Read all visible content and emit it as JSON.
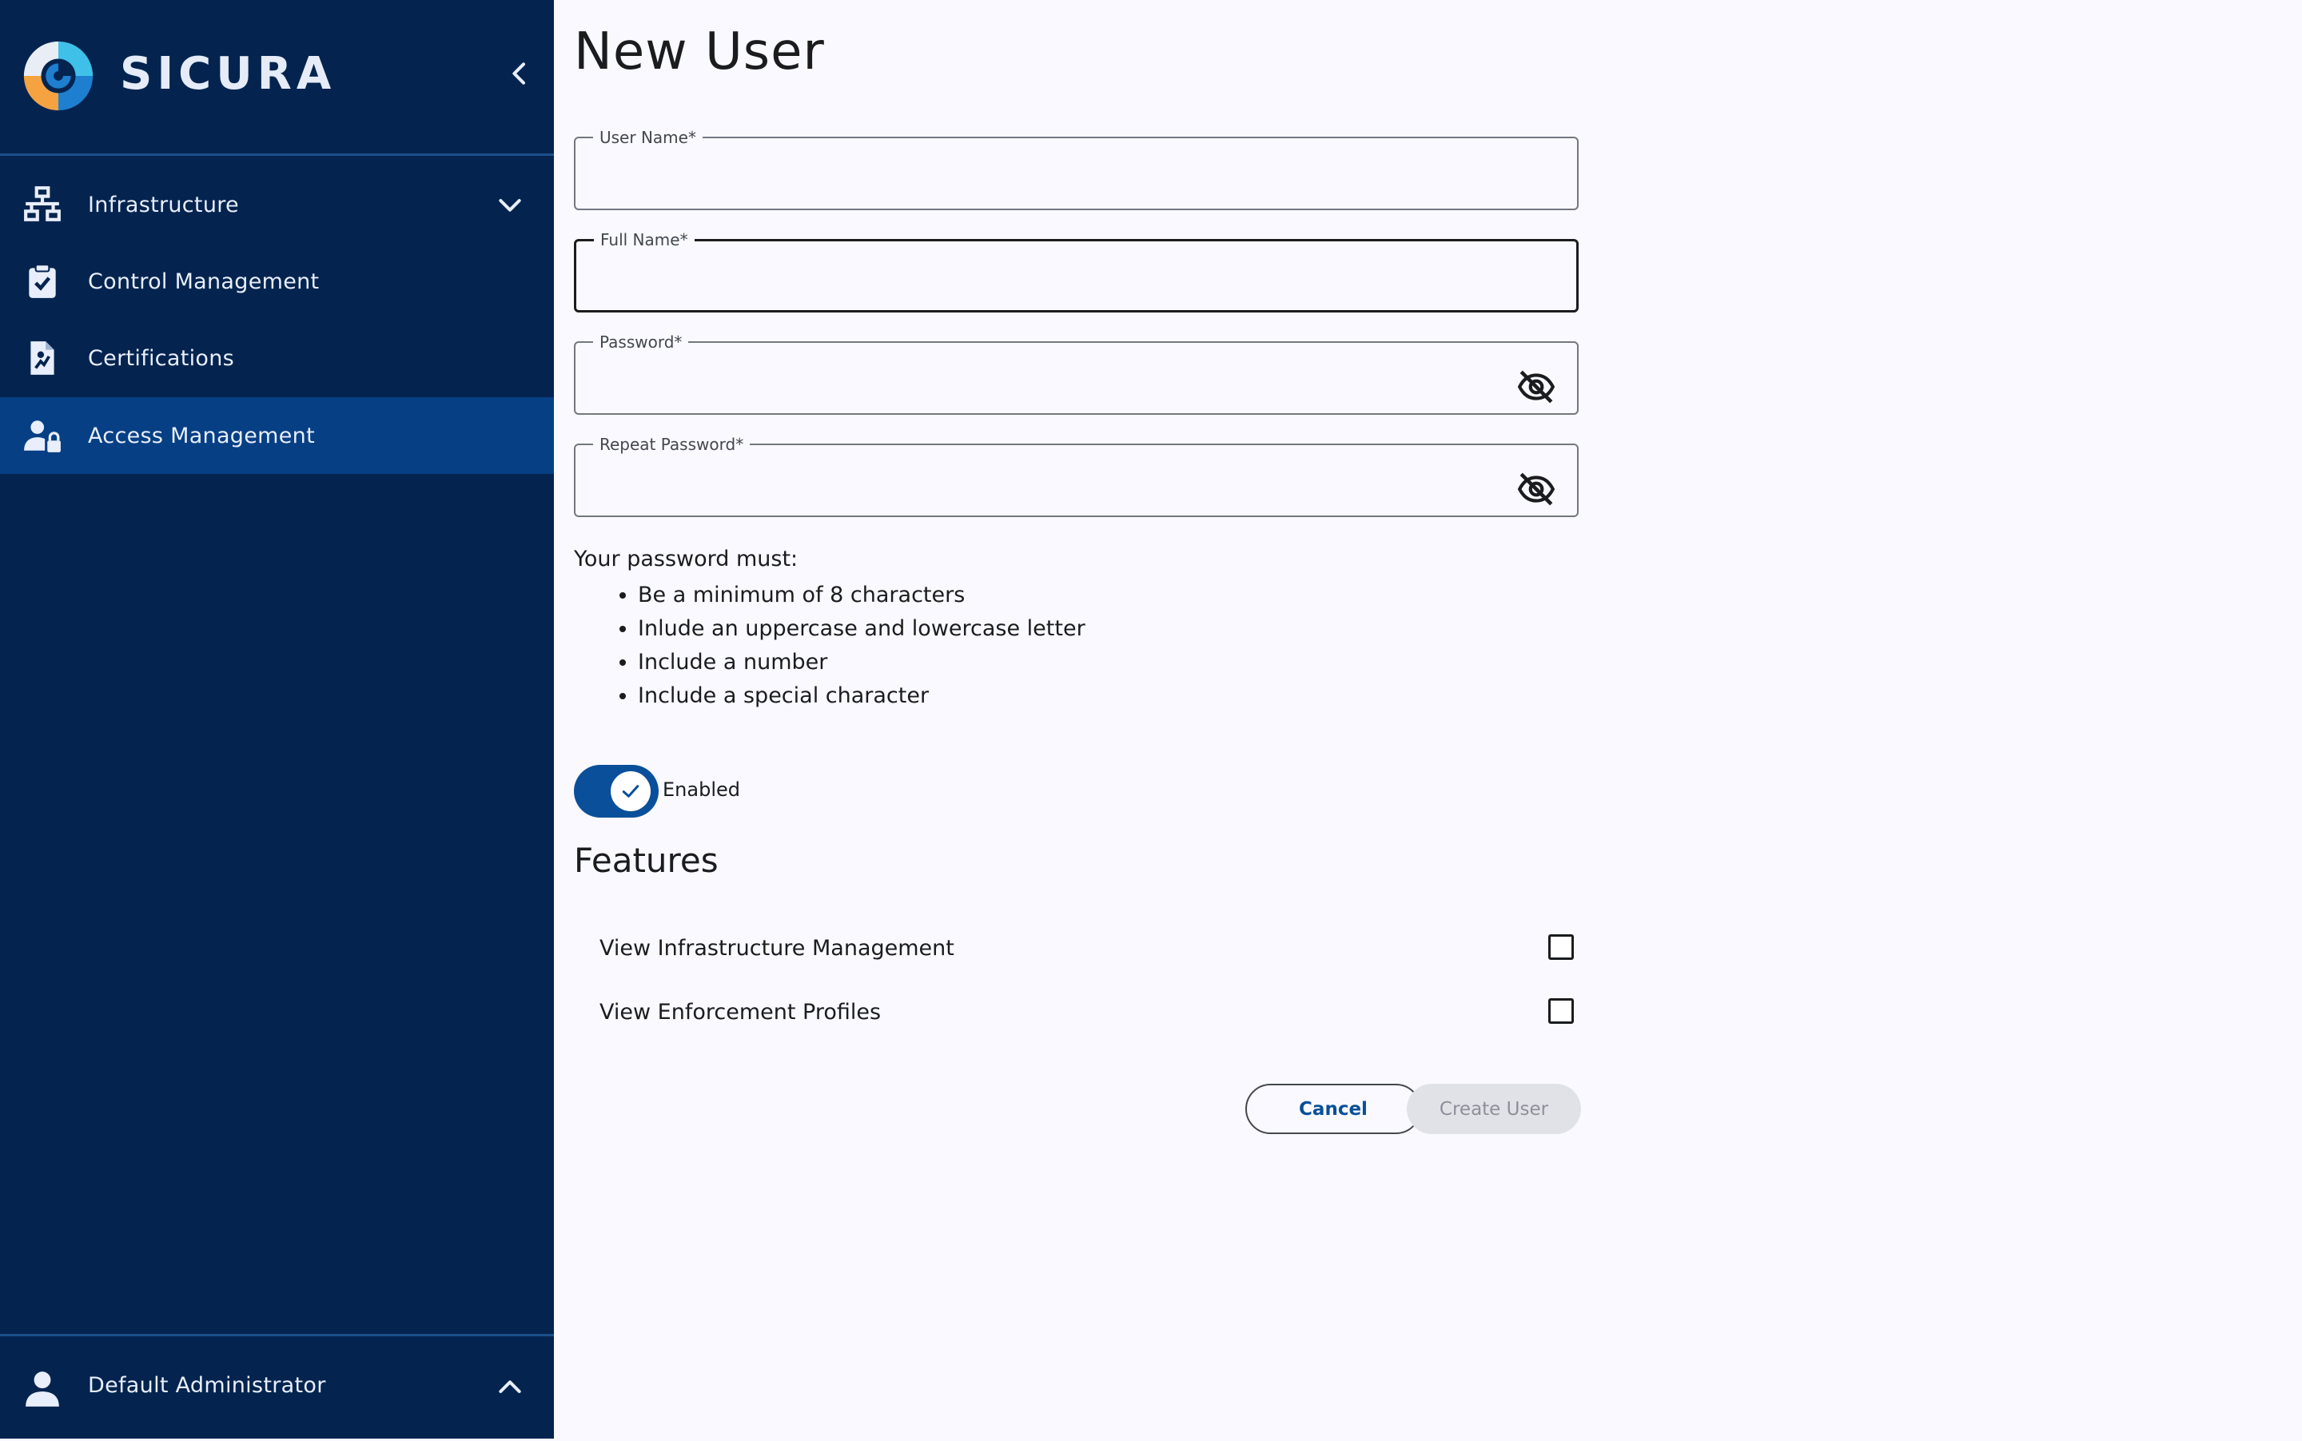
{
  "brand": {
    "name": "SICURA"
  },
  "sidebar": {
    "items": [
      {
        "label": "Infrastructure",
        "icon": "network-icon",
        "expandable": true
      },
      {
        "label": "Control Management",
        "icon": "clipboard-check-icon"
      },
      {
        "label": "Certifications",
        "icon": "certificate-document-icon"
      },
      {
        "label": "Access Management",
        "icon": "user-lock-icon",
        "active": true
      }
    ],
    "footer": {
      "user": "Default Administrator"
    }
  },
  "page": {
    "title": "New User"
  },
  "form": {
    "username": {
      "label": "User Name",
      "value": ""
    },
    "fullname": {
      "label": "Full Name",
      "value": ""
    },
    "password": {
      "label": "Password",
      "value": ""
    },
    "repeat_password": {
      "label": "Repeat Password",
      "value": ""
    },
    "required_marker": "*"
  },
  "rules": {
    "heading": "Your password must:",
    "items": [
      "Be a minimum of 8 characters",
      "Inlude an uppercase and lowercase letter",
      "Include a number",
      "Include a special character"
    ]
  },
  "enabled": {
    "label": "Enabled",
    "checked": true
  },
  "features": {
    "title": "Features",
    "items": [
      {
        "label": "View Infrastructure Management",
        "checked": false
      },
      {
        "label": "View Enforcement Profiles",
        "checked": false
      }
    ]
  },
  "actions": {
    "cancel": "Cancel",
    "create": "Create User"
  },
  "colors": {
    "sidebar_bg": "#04244f",
    "sidebar_active": "#063f84",
    "accent": "#0a4f99",
    "page_bg": "#f9f9ff"
  }
}
